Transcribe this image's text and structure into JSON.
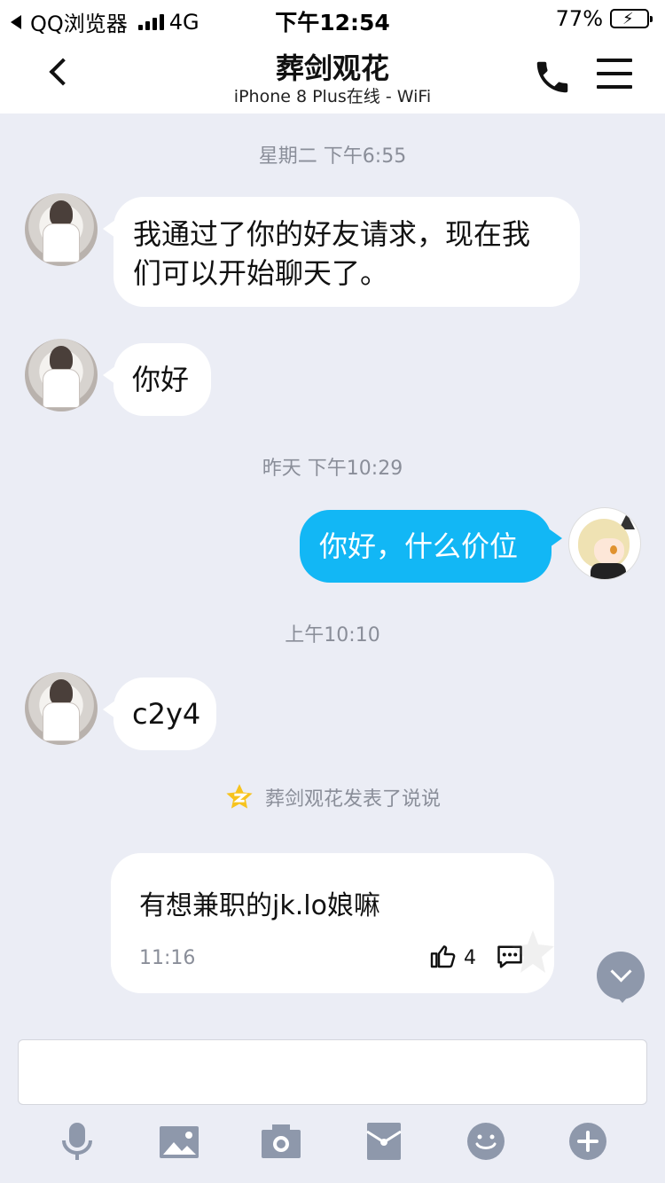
{
  "status_bar": {
    "app": "QQ浏览器",
    "network": "4G",
    "time": "下午12:54",
    "battery_percent": "77%",
    "battery_level": 0.77
  },
  "header": {
    "title": "葬剑观花",
    "subtitle": "iPhone 8 Plus在线 - WiFi"
  },
  "messages": {
    "ts1": "星期二 下午6:55",
    "msg1_line1": "我通过了你的好友请求，现在我",
    "msg1_line2": "们可以开始聊天了。",
    "msg2": "你好",
    "ts2": "昨天 下午10:29",
    "msg3": "你好，什么价位",
    "ts3": "上午10:10",
    "msg4": "c2y4"
  },
  "notice": {
    "text": "葬剑观花发表了说说"
  },
  "post_card": {
    "text": "有想兼职的jk.lo娘嘛",
    "time": "11:16",
    "likes": "4"
  },
  "colors": {
    "background": "#ebedf5",
    "bubble_self": "#12b7f5",
    "toolbar_icon": "#8e98ab",
    "qzone_star": "#f7c31d"
  },
  "toolbar": {
    "icons": [
      "microphone-icon",
      "image-icon",
      "camera-icon",
      "red-packet-icon",
      "emoji-icon",
      "plus-icon"
    ]
  }
}
